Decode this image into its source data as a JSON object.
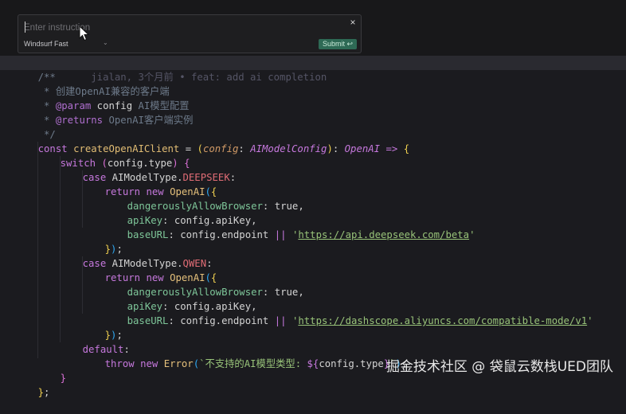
{
  "popup": {
    "placeholder": "Enter instruction",
    "close_glyph": "×",
    "model": "Windsurf Fast",
    "model_chevron": "⌄",
    "submit_label": "Submit ↩"
  },
  "editor": {
    "blame": "jialan, 3个月前 • feat: add ai completion",
    "comment_open": "/**",
    "doc_line1": " * 创建OpenAI兼容的客户端",
    "doc_param_tag": "@param",
    "doc_param_name": "config",
    "doc_param_desc": "AI模型配置",
    "doc_returns_tag": "@returns",
    "doc_returns_desc": "OpenAI客户端实例",
    "comment_close": " */",
    "kw_const": "const",
    "fn_name": "createOpenAIClient",
    "param_name": "config",
    "param_type": "AIModelConfig",
    "return_type": "OpenAI",
    "kw_switch": "switch",
    "switch_expr": "config.type",
    "kw_case": "case",
    "enum_type": "AIModelType.",
    "enum_deepseek": "DEEPSEEK",
    "enum_qwen": "QWEN",
    "kw_return": "return",
    "kw_new": "new",
    "class_openai": "OpenAI",
    "prop_dangerous": "dangerouslyAllowBrowser",
    "val_true": "true",
    "prop_apikey": "apiKey",
    "val_apikey": "config.apiKey,",
    "prop_baseurl": "baseURL",
    "val_endpoint": "config.endpoint",
    "op_or": "||",
    "url_deepseek": "https://api.deepseek.com/beta",
    "url_qwen": "https://dashscope.aliyuncs.com/compatible-mode/v1",
    "kw_default": "default",
    "kw_throw": "throw",
    "class_error": "Error",
    "error_template_text": "不支持的AI模型类型: ",
    "error_template_expr": "config.type"
  },
  "watermark": "掘金技术社区 @ 袋鼠云数栈UED团队"
}
